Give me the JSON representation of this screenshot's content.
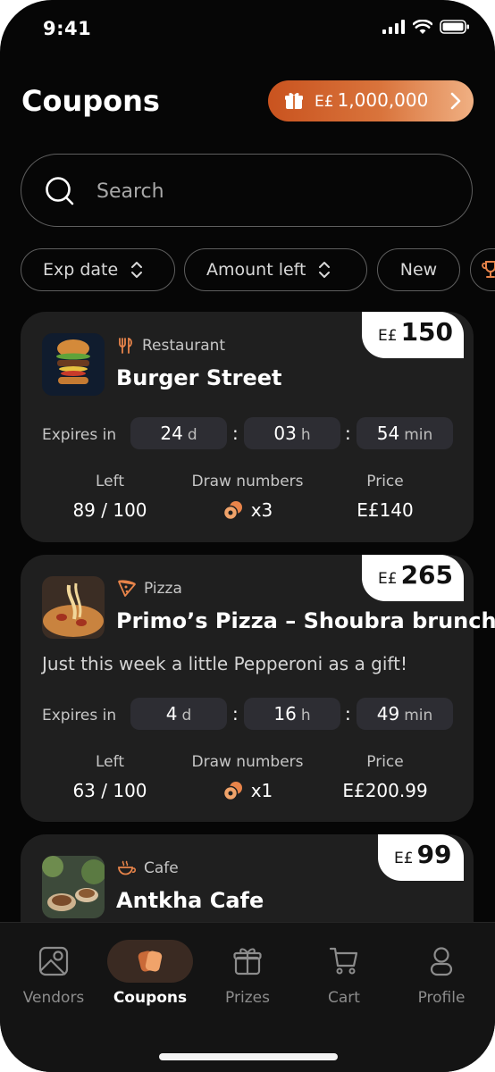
{
  "status_bar": {
    "time": "9:41"
  },
  "header": {
    "title": "Coupons"
  },
  "balance": {
    "currency": "E£",
    "amount": "1,000,000",
    "accent": "#D9743C"
  },
  "search": {
    "placeholder": "Search"
  },
  "filters": [
    {
      "label": "Exp date",
      "sortable": true
    },
    {
      "label": "Amount left",
      "sortable": true
    },
    {
      "label": "New",
      "sortable": false
    },
    {
      "label": "",
      "icon": "trophy-icon"
    }
  ],
  "labels": {
    "expires_in": "Expires in",
    "left": "Left",
    "draw_numbers": "Draw numbers",
    "price": "Price",
    "days": "d",
    "hours": "h",
    "minutes": "min"
  },
  "coupons": [
    {
      "value_currency": "E£",
      "value": "150",
      "category": "Restaurant",
      "category_icon": "restaurant-icon",
      "name": "Burger Street",
      "description": "",
      "expires": {
        "days": "24",
        "hours": "03",
        "minutes": "54"
      },
      "left": "89 / 100",
      "draw_numbers": "x3",
      "price": "E£140"
    },
    {
      "value_currency": "E£",
      "value": "265",
      "category": "Pizza",
      "category_icon": "pizza-icon",
      "name": "Primo’s Pizza – Shoubra brunch",
      "description": "Just this week a little Pepperoni as a gift!",
      "expires": {
        "days": "4",
        "hours": "16",
        "minutes": "49"
      },
      "left": "63 / 100",
      "draw_numbers": "x1",
      "price": "E£200.99"
    },
    {
      "value_currency": "E£",
      "value": "99",
      "category": "Cafe",
      "category_icon": "cafe-icon",
      "name": "Antkha Cafe"
    }
  ],
  "nav": [
    {
      "label": "Vendors",
      "icon": "vendors-map-icon",
      "active": false
    },
    {
      "label": "Coupons",
      "icon": "coupons-icon",
      "active": true
    },
    {
      "label": "Prizes",
      "icon": "prizes-gift-icon",
      "active": false
    },
    {
      "label": "Cart",
      "icon": "cart-icon",
      "active": false
    },
    {
      "label": "Profile",
      "icon": "profile-icon",
      "active": false
    }
  ]
}
